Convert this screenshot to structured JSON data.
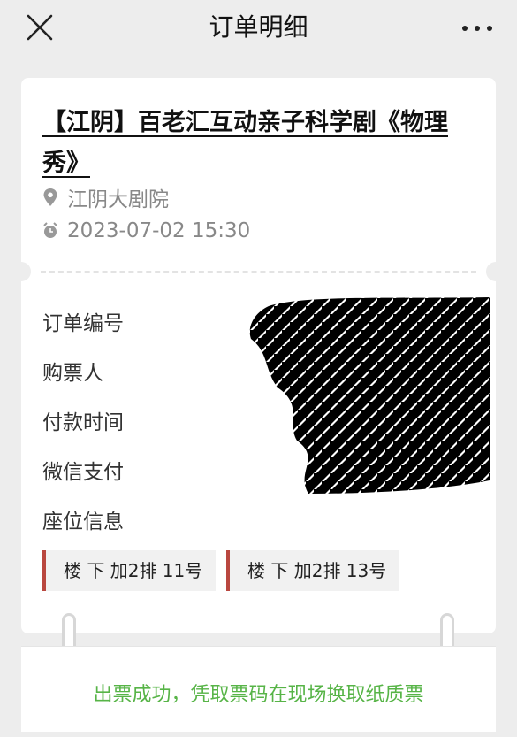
{
  "header": {
    "title": "订单明细",
    "close_icon": "close-icon",
    "more_icon": "more-horizontal-icon"
  },
  "event": {
    "title": "【江阴】百老汇互动亲子科学剧《物理秀》",
    "venue": "江阴大剧院",
    "venue_icon": "location-pin-icon",
    "datetime": "2023-07-02 15:30",
    "datetime_icon": "alarm-clock-icon"
  },
  "order": {
    "labels": {
      "order_no": "订单编号",
      "buyer": "购票人",
      "pay_time": "付款时间",
      "payment": "微信支付",
      "seat_info": "座位信息"
    },
    "seats": [
      "楼 下 加2排 11号",
      "楼 下 加2排 13号"
    ]
  },
  "status": {
    "message": "出票成功，凭取票码在现场换取纸质票"
  },
  "colors": {
    "background": "#ededed",
    "seat_accent": "#b9473f",
    "success_text": "#57b447"
  }
}
